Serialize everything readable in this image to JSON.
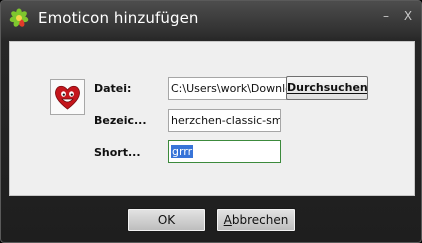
{
  "window": {
    "title": "Emoticon hinzufügen",
    "minimize_glyph": "–",
    "close_glyph": "X"
  },
  "form": {
    "file_label": "Datei:",
    "file_value": "C:\\Users\\work\\Downlo",
    "browse_label": "Durchsuchen...",
    "name_label": "Bezeic...",
    "name_value": "herzchen-classic-smiley",
    "shortcut_label": "Short...",
    "shortcut_value": "grrr"
  },
  "buttons": {
    "ok_label": "OK",
    "cancel_label_rest": "bbrechen",
    "cancel_label_mnemonic": "A"
  },
  "icons": {
    "app": "icq-flower-icon",
    "preview": "heart-smiley-icon"
  },
  "colors": {
    "accent_selection": "#3874d8",
    "focus_border": "#3c8a3c"
  }
}
